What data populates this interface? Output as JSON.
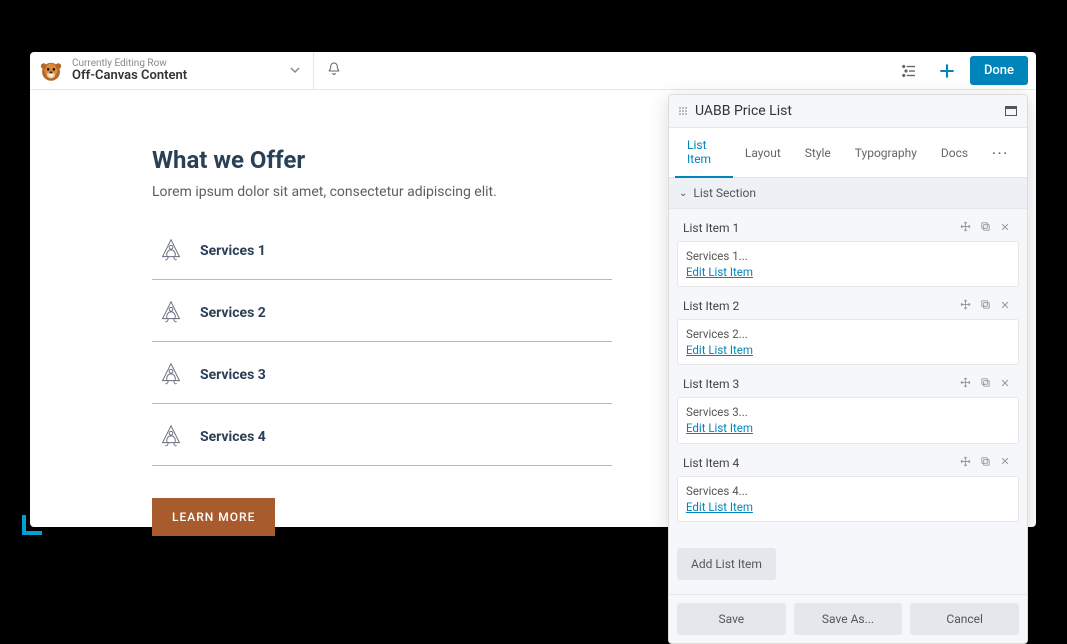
{
  "topbar": {
    "editing_label": "Currently Editing Row",
    "title": "Off-Canvas Content",
    "done": "Done"
  },
  "canvas": {
    "heading": "What we Offer",
    "subheading": "Lorem ipsum dolor sit amet, consectetur adipiscing elit.",
    "services": [
      "Services 1",
      "Services 2",
      "Services 3",
      "Services 4"
    ],
    "learn_more": "LEARN MORE"
  },
  "panel": {
    "title": "UABB Price List",
    "tabs": [
      "List Item",
      "Layout",
      "Style",
      "Typography",
      "Docs"
    ],
    "active_tab": 0,
    "section": "List Section",
    "items": [
      {
        "label": "List Item 1",
        "preview": "Services 1...",
        "edit": "Edit List Item"
      },
      {
        "label": "List Item 2",
        "preview": "Services 2...",
        "edit": "Edit List Item"
      },
      {
        "label": "List Item 3",
        "preview": "Services 3...",
        "edit": "Edit List Item"
      },
      {
        "label": "List Item 4",
        "preview": "Services 4...",
        "edit": "Edit List Item"
      }
    ],
    "add": "Add List Item",
    "footer": {
      "save": "Save",
      "save_as": "Save As...",
      "cancel": "Cancel"
    }
  }
}
